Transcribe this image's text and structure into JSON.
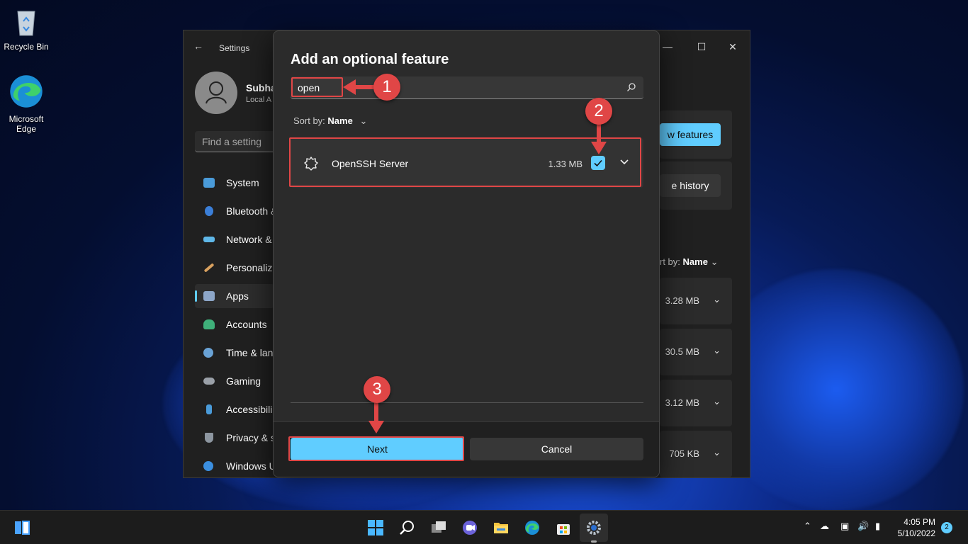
{
  "desktop": {
    "icons": [
      {
        "label": "Recycle Bin"
      },
      {
        "label": "Microsoft Edge"
      }
    ]
  },
  "settings": {
    "title": "Settings",
    "user_name": "Subha",
    "user_sub": "Local A",
    "search_placeholder": "Find a setting",
    "nav": [
      {
        "label": "System",
        "icon": "monitor-icon"
      },
      {
        "label": "Bluetooth &",
        "icon": "bluetooth-icon"
      },
      {
        "label": "Network &",
        "icon": "wifi-icon"
      },
      {
        "label": "Personaliza",
        "icon": "brush-icon"
      },
      {
        "label": "Apps",
        "icon": "apps-icon",
        "active": true
      },
      {
        "label": "Accounts",
        "icon": "person-icon"
      },
      {
        "label": "Time & lan",
        "icon": "clock-icon"
      },
      {
        "label": "Gaming",
        "icon": "gamepad-icon"
      },
      {
        "label": "Accessibili",
        "icon": "accessibility-icon"
      },
      {
        "label": "Privacy & s",
        "icon": "shield-icon"
      },
      {
        "label": "Windows U",
        "icon": "update-icon"
      }
    ],
    "view_features_label": "w features",
    "history_label": "e history",
    "sort_prefix": "rt by:",
    "sort_value": "Name",
    "sizes": [
      "3.28 MB",
      "30.5 MB",
      "3.12 MB",
      "705 KB"
    ]
  },
  "dialog": {
    "title": "Add an optional feature",
    "search_value": "open",
    "sort_prefix": "Sort by:",
    "sort_value": "Name",
    "feature": {
      "name": "OpenSSH Server",
      "size": "1.33 MB",
      "checked": true
    },
    "next_label": "Next",
    "cancel_label": "Cancel"
  },
  "annotations": {
    "steps": [
      "1",
      "2",
      "3"
    ],
    "color": "#e04646"
  },
  "taskbar": {
    "time": "4:05 PM",
    "date": "5/10/2022",
    "notifications": "2",
    "accent": "#60cdff"
  }
}
